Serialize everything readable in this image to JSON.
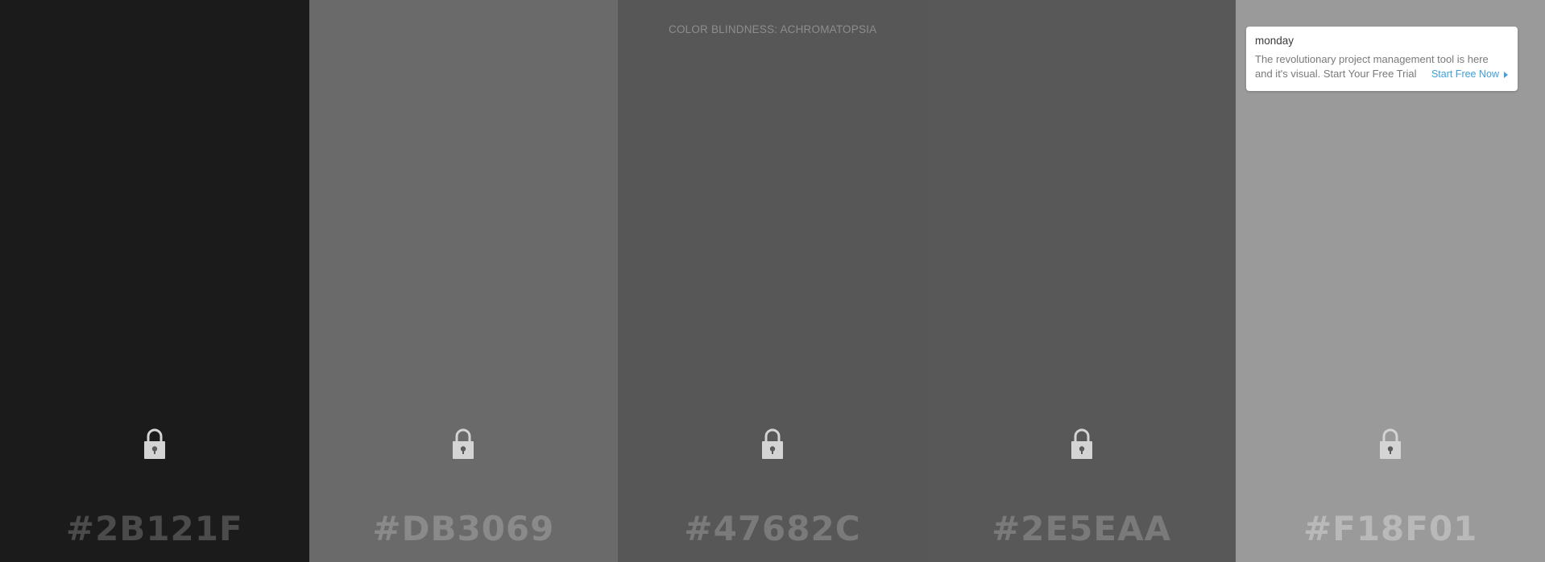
{
  "mode_label": "COLOR BLINDNESS: ACHROMATOPSIA",
  "colors": {
    "mode_label": "#8d8d8d",
    "lock_body": "#d4d4d4",
    "lock_hole": "#5a5a5a"
  },
  "swatches": [
    {
      "hex": "#2B121F",
      "display_bg": "#1b1b1b",
      "text_color": "#4b4b4b",
      "lock_icon": "lock-icon"
    },
    {
      "hex": "#DB3069",
      "display_bg": "#6a6a6a",
      "text_color": "#8a8a8a",
      "lock_icon": "lock-icon"
    },
    {
      "hex": "#47682C",
      "display_bg": "#575757",
      "text_color": "#7a7a7a",
      "lock_icon": "lock-icon"
    },
    {
      "hex": "#2E5EAA",
      "display_bg": "#585858",
      "text_color": "#7a7a7a",
      "lock_icon": "lock-icon"
    },
    {
      "hex": "#F18F01",
      "display_bg": "#9a9a9a",
      "text_color": "#b9b9b9",
      "lock_icon": "lock-icon"
    }
  ],
  "ad": {
    "brand": "monday",
    "text": "The revolutionary project management tool is here and it's visual. Start Your Free Trial",
    "cta": "Start Free Now"
  }
}
